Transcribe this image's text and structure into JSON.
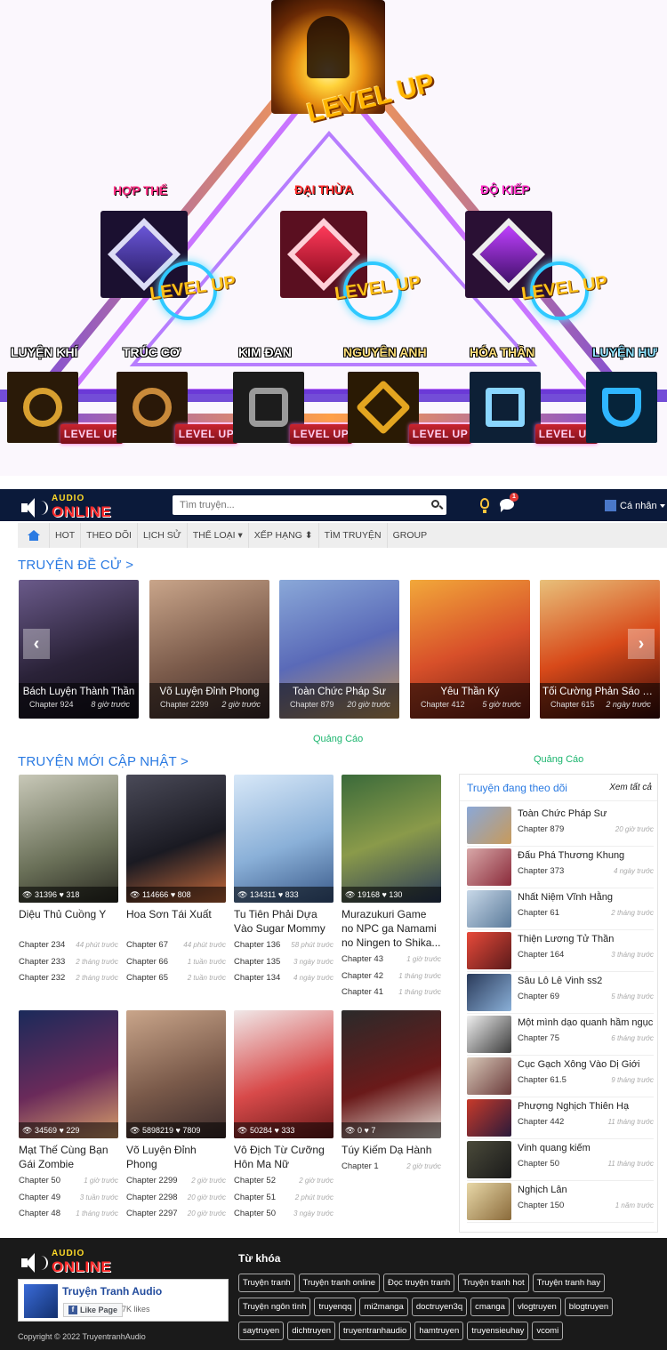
{
  "hero": {
    "top_badge": "LEVEL UP",
    "mid_ranks": [
      {
        "title": "HỢP THỂ",
        "color": "#ff2f84"
      },
      {
        "title": "ĐẠI THỪA",
        "color": "#ff2f2f"
      },
      {
        "title": "ĐỘ KIẾP",
        "color": "#ff2fc8"
      }
    ],
    "mid_badge": "LEVEL UP",
    "low_ranks": [
      {
        "title": "LUYỆN KHÍ",
        "color": "#ffffff"
      },
      {
        "title": "TRÚC CƠ",
        "color": "#ffffff"
      },
      {
        "title": "KIM ĐAN",
        "color": "#ffffff"
      },
      {
        "title": "NGUYÊN ANH",
        "color": "#ffe07a"
      },
      {
        "title": "HÓA THẦN",
        "color": "#ffe07a"
      },
      {
        "title": "LUYỆN HƯ",
        "color": "#8fe3ff"
      }
    ],
    "low_badge": "LEVEL UP"
  },
  "header": {
    "logo_top": "AUDIO",
    "logo_bottom": "ONLINE",
    "search_placeholder": "Tìm truyện...",
    "notification_count": "1",
    "user_label": "Cá nhân"
  },
  "nav": [
    "HOT",
    "THEO DÕI",
    "LỊCH SỬ",
    "THỂ LOẠI ▾",
    "XẾP HẠNG ⬍",
    "TÌM TRUYỆN",
    "GROUP"
  ],
  "featured": {
    "title": "TRUYỆN ĐỀ CỬ >",
    "items": [
      {
        "name": "Bách Luyện Thành Thần",
        "chapter": "Chapter 924",
        "time": "8 giờ trước"
      },
      {
        "name": "Võ Luyện Đỉnh Phong",
        "chapter": "Chapter 2299",
        "time": "2 giờ trước"
      },
      {
        "name": "Toàn Chức Pháp Sư",
        "chapter": "Chapter 879",
        "time": "20 giờ trước"
      },
      {
        "name": "Yêu Thần Ký",
        "chapter": "Chapter 412",
        "time": "5 giờ trước"
      },
      {
        "name": "Tối Cường Phản Sáo Lộ ...",
        "chapter": "Chapter 615",
        "time": "2 ngày trước"
      }
    ]
  },
  "ads": {
    "center": "Quảng Cáo",
    "sidebar": "Quảng Cáo"
  },
  "updates": {
    "title": "TRUYỆN MỚI CẬP NHẬT >",
    "cards": [
      {
        "views": "31396",
        "likes": "318",
        "name": "Diệu Thủ Cuồng Y",
        "chapters": [
          [
            "Chapter 234",
            "44 phút trước"
          ],
          [
            "Chapter 233",
            "2 tháng trước"
          ],
          [
            "Chapter 232",
            "2 tháng trước"
          ]
        ]
      },
      {
        "views": "114666",
        "likes": "808",
        "name": "Hoa Sơn Tái Xuất",
        "chapters": [
          [
            "Chapter 67",
            "44 phút trước"
          ],
          [
            "Chapter 66",
            "1 tuần trước"
          ],
          [
            "Chapter 65",
            "2 tuần trước"
          ]
        ]
      },
      {
        "views": "134311",
        "likes": "833",
        "name": "Tu Tiên Phải Dựa Vào Sugar Mommy",
        "chapters": [
          [
            "Chapter 136",
            "58 phút trước"
          ],
          [
            "Chapter 135",
            "3 ngày trước"
          ],
          [
            "Chapter 134",
            "4 ngày trước"
          ]
        ]
      },
      {
        "views": "19168",
        "likes": "130",
        "name": "Murazukuri Game no NPC ga Namami no Ningen to Shika...",
        "chapters": [
          [
            "Chapter 43",
            "1 giờ trước"
          ],
          [
            "Chapter 42",
            "1 tháng trước"
          ],
          [
            "Chapter 41",
            "1 tháng trước"
          ]
        ]
      },
      {
        "views": "34569",
        "likes": "229",
        "name": "Mạt Thế Cùng Bạn Gái Zombie",
        "chapters": [
          [
            "Chapter 50",
            "1 giờ trước"
          ],
          [
            "Chapter 49",
            "3 tuần trước"
          ],
          [
            "Chapter 48",
            "1 tháng trước"
          ]
        ]
      },
      {
        "views": "5898219",
        "likes": "7809",
        "name": "Võ Luyện Đỉnh Phong",
        "chapters": [
          [
            "Chapter 2299",
            "2 giờ trước"
          ],
          [
            "Chapter 2298",
            "20 giờ trước"
          ],
          [
            "Chapter 2297",
            "20 giờ trước"
          ]
        ]
      },
      {
        "views": "50284",
        "likes": "333",
        "name": "Vô Địch Từ Cưỡng Hôn Ma Nữ",
        "chapters": [
          [
            "Chapter 52",
            "2 giờ trước"
          ],
          [
            "Chapter 51",
            "2 phút trước"
          ],
          [
            "Chapter 50",
            "3 ngày trước"
          ]
        ]
      },
      {
        "views": "0",
        "likes": "7",
        "name": "Túy Kiếm Dạ Hành",
        "chapters": [
          [
            "Chapter 1",
            "2 giờ trước"
          ]
        ]
      }
    ]
  },
  "follow": {
    "title": "Truyện đang theo dõi",
    "see_all": "Xem tất cả",
    "items": [
      {
        "name": "Toàn Chức Pháp Sư",
        "chapter": "Chapter 879",
        "time": "20 giờ trước"
      },
      {
        "name": "Đấu Phá Thương Khung",
        "chapter": "Chapter 373",
        "time": "4 ngày trước"
      },
      {
        "name": "Nhất Niệm Vĩnh Hằng",
        "chapter": "Chapter 61",
        "time": "2 tháng trước"
      },
      {
        "name": "Thiện Lương Tử Thần",
        "chapter": "Chapter 164",
        "time": "3 tháng trước"
      },
      {
        "name": "Sâu Lô Lê Vinh ss2",
        "chapter": "Chapter 69",
        "time": "5 tháng trước"
      },
      {
        "name": "Một mình dạo quanh hầm ngục",
        "chapter": "Chapter 75",
        "time": "6 tháng trước"
      },
      {
        "name": "Cục Gạch Xông Vào Dị Giới",
        "chapter": "Chapter 61.5",
        "time": "9 tháng trước"
      },
      {
        "name": "Phượng Nghịch Thiên Hạ",
        "chapter": "Chapter 442",
        "time": "11 tháng trước"
      },
      {
        "name": "Vinh quang kiếm",
        "chapter": "Chapter 50",
        "time": "11 tháng trước"
      },
      {
        "name": "Nghịch Lân",
        "chapter": "Chapter 150",
        "time": "1 năm trước"
      }
    ]
  },
  "footer": {
    "fb_name": "Truyện Tranh Audio",
    "fb_like": "Like Page",
    "fb_likes": "7K likes",
    "copyright": "Copyright © 2022 TruyentranhAudio",
    "keywords_title": "Từ khóa",
    "keywords": [
      "Truyện tranh",
      "Truyện tranh online",
      "Đọc truyện tranh",
      "Truyện tranh hot",
      "Truyện tranh hay",
      "Truyện ngôn tình",
      "truyenqq",
      "mi2manga",
      "doctruyen3q",
      "cmanga",
      "vlogtruyen",
      "blogtruyen",
      "saytruyen",
      "dichtruyen",
      "truyentranhaudio",
      "hamtruyen",
      "truyensieuhay",
      "vcomi"
    ]
  }
}
